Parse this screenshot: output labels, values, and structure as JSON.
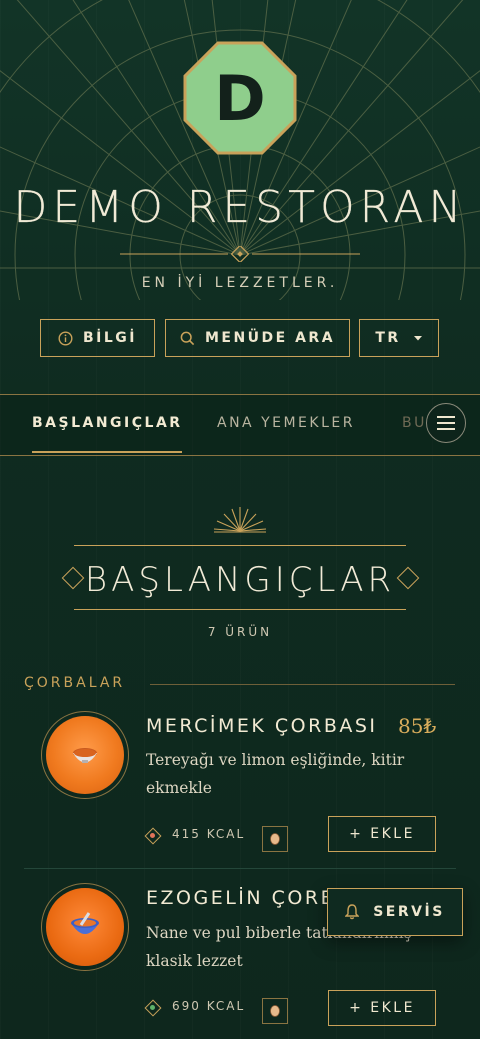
{
  "brand": {
    "logo_letter": "D",
    "name": "DEMO RESTORAN",
    "tagline": "EN İYİ LEZZETLER."
  },
  "actions": {
    "info_label": "BİLGİ",
    "search_label": "MENÜDE ARA",
    "language_label": "TR"
  },
  "tabs": [
    {
      "label": "BAŞLANGIÇLAR",
      "active": true
    },
    {
      "label": "ANA YEMEKLER",
      "active": false
    },
    {
      "label": "BU",
      "active": false
    }
  ],
  "section": {
    "title": "BAŞLANGIÇLAR",
    "count": "7 ÜRÜN"
  },
  "category": {
    "title": "ÇORBALAR"
  },
  "items": [
    {
      "name": "MERCİMEK ÇORBASI",
      "price": "85₺",
      "description": "Tereyağı ve limon eşliğinde, kitir ekmekle",
      "kcal": "415 KCAL",
      "add_label": "+ EKLE",
      "dot_color": "#e0735a"
    },
    {
      "name": "EZOGELİN ÇORB",
      "price": "",
      "description": "Nane ve pul biberle tatlandırılmış klasik lezzet",
      "kcal": "690 KCAL",
      "add_label": "+ EKLE",
      "dot_color": "#5fb36a"
    }
  ],
  "service_button": {
    "label": "SERVİS"
  },
  "colors": {
    "background": "#0f2a20",
    "gold": "#c9a25a",
    "logo_green": "#8fce8c",
    "thumb_orange": "#f07a1f"
  },
  "icons": [
    "info-icon",
    "search-icon",
    "caret-down-icon",
    "hamburger-menu-icon",
    "bell-icon",
    "bowl-icon",
    "allergen-icon"
  ]
}
